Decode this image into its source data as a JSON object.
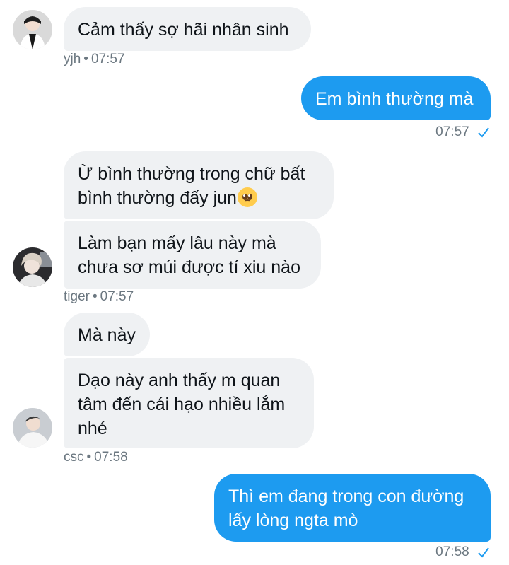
{
  "messages": [
    {
      "id": "m1",
      "from": "yjh",
      "text": "Cảm thấy sợ hãi nhân sinh"
    },
    {
      "id": "m2",
      "from": "me",
      "text": "Em bình thường mà"
    },
    {
      "id": "m3",
      "from": "tiger",
      "line1": "Ừ bình thường trong chữ bất",
      "line2": "bình thường đấy jun",
      "emoji": "pleading-face-emoji"
    },
    {
      "id": "m4",
      "from": "tiger",
      "line1": "Làm bạn mấy lâu này mà",
      "line2": "chưa sơ múi được tí xiu nào"
    },
    {
      "id": "m5",
      "from": "csc",
      "text": "Mà này"
    },
    {
      "id": "m6",
      "from": "csc",
      "line1": "Dạo này anh thấy m quan",
      "line2": "tâm đến cái hạo nhiều lắm",
      "line3": "nhé"
    },
    {
      "id": "m7",
      "from": "me",
      "line1": "Thì em đang trong con đường",
      "line2": "lấy lòng ngta mò"
    }
  ],
  "meta": {
    "yjh": {
      "name": "yjh",
      "time": "07:57"
    },
    "me1": {
      "time": "07:57"
    },
    "tiger": {
      "name": "tiger",
      "time": "07:57"
    },
    "csc": {
      "name": "csc",
      "time": "07:58"
    },
    "me2": {
      "time": "07:58"
    }
  },
  "separator": "•",
  "colors": {
    "outgoing": "#1d9bf0",
    "incoming": "#eff1f3",
    "meta": "#6b7780",
    "check": "#1d9bf0"
  },
  "icons": {
    "read": "check-icon"
  }
}
